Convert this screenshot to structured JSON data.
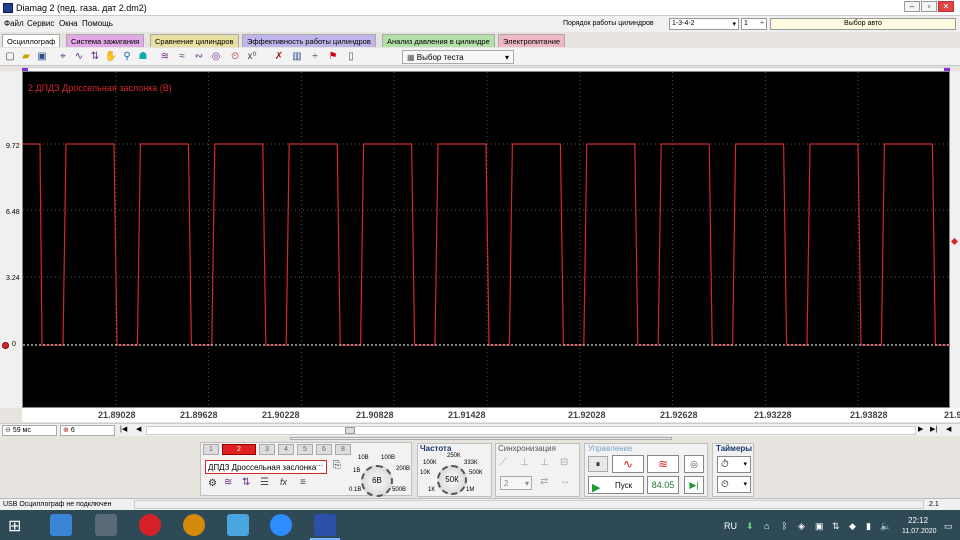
{
  "titlebar": {
    "title": "Diamag 2 (пед. газа. дат 2.dm2)"
  },
  "menu": [
    "Файл",
    "Сервис",
    "Окна",
    "Помощь"
  ],
  "cylinder_order": {
    "label": "Порядок работы цилиндров",
    "value": "1-3-4-2",
    "count": "1"
  },
  "vehicle_select": "Выбор авто",
  "tabs": [
    {
      "label": "Осциллограф",
      "color": "#ffffff"
    },
    {
      "label": "Система зажигания",
      "color": "#e2a8e8"
    },
    {
      "label": "Сравнение цилиндров",
      "color": "#e8e0a0"
    },
    {
      "label": "Эффективность работы цилиндров",
      "color": "#c0b6ec"
    },
    {
      "label": "Анализ давления в цилиндре",
      "color": "#b2e0a8"
    },
    {
      "label": "Электропитание",
      "color": "#f0b8c6"
    }
  ],
  "toolbar": {
    "test_select": "Выбор теста"
  },
  "channel_label": "2 ДПДЗ Дроссельная заслонка (В)",
  "y_ticks": [
    "9.72",
    "6.48",
    "3.24",
    "0"
  ],
  "x_ticks": [
    "21.89028",
    "21.89628",
    "21.90228",
    "21.90828",
    "21.91428",
    "21.92028",
    "21.92628",
    "21.93228",
    "21.93828",
    "21.9"
  ],
  "controls": {
    "timebase": "59 мс",
    "channel_count": "6"
  },
  "channels": [
    "1",
    "2",
    "3",
    "4",
    "5",
    "6",
    "8"
  ],
  "channel_name": "ДПДЗ Дроссельная заслонка",
  "voltage": {
    "value": "6В",
    "labels": [
      "10В",
      "100В",
      "1В",
      "200В",
      "0.1В",
      "500В"
    ]
  },
  "frequency": {
    "title": "Частота",
    "value": "50К",
    "labels": [
      "250К",
      "100К",
      "333К",
      "10К",
      "500К",
      "1К",
      "1М"
    ]
  },
  "sync": {
    "title": "Синхронизация",
    "value": "2"
  },
  "control": {
    "title": "Управление",
    "start_label": "Пуск",
    "value": "84.05"
  },
  "timers": {
    "title": "Таймеры"
  },
  "status": {
    "left": "USB Осциллограф не подключен",
    "right": "2.1"
  },
  "taskbar": {
    "lang": "RU",
    "time": "22:12",
    "date": "11.07.2020"
  },
  "signal": {
    "high_v": 9.72,
    "low_v": 0,
    "pulses": 12,
    "color": "#d4282d"
  }
}
